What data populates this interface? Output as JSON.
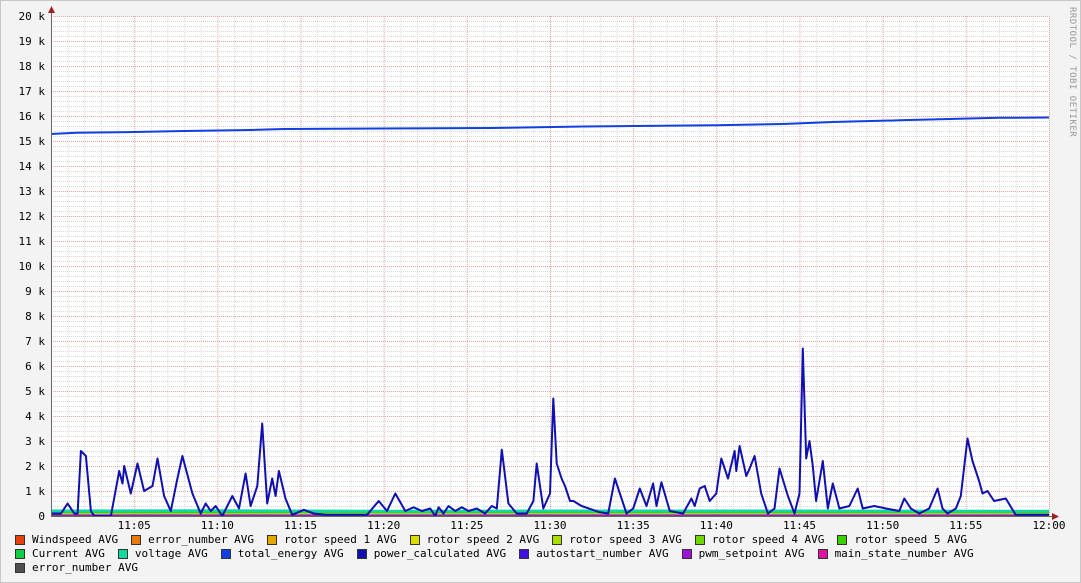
{
  "watermark": "RRDTOOL / TOBI OETIKER",
  "chart_data": {
    "type": "line",
    "title": "",
    "xlabel": "",
    "ylabel": "",
    "x_unit": "minutes after 11:00",
    "xlim": [
      0,
      60
    ],
    "ylim": [
      0,
      20000
    ],
    "grid": true,
    "legend_placement": "bottom",
    "x_ticks": [
      {
        "t": 5,
        "label": "11:05"
      },
      {
        "t": 10,
        "label": "11:10"
      },
      {
        "t": 15,
        "label": "11:15"
      },
      {
        "t": 20,
        "label": "11:20"
      },
      {
        "t": 25,
        "label": "11:25"
      },
      {
        "t": 30,
        "label": "11:30"
      },
      {
        "t": 35,
        "label": "11:35"
      },
      {
        "t": 40,
        "label": "11:40"
      },
      {
        "t": 45,
        "label": "11:45"
      },
      {
        "t": 50,
        "label": "11:50"
      },
      {
        "t": 55,
        "label": "11:55"
      },
      {
        "t": 60,
        "label": "12:00"
      }
    ],
    "y_ticks": [
      {
        "v": 0,
        "label": "0"
      },
      {
        "v": 1000,
        "label": "1 k"
      },
      {
        "v": 2000,
        "label": "2 k"
      },
      {
        "v": 3000,
        "label": "3 k"
      },
      {
        "v": 4000,
        "label": "4 k"
      },
      {
        "v": 5000,
        "label": "5 k"
      },
      {
        "v": 6000,
        "label": "6 k"
      },
      {
        "v": 7000,
        "label": "7 k"
      },
      {
        "v": 8000,
        "label": "8 k"
      },
      {
        "v": 9000,
        "label": "9 k"
      },
      {
        "v": 10000,
        "label": "10 k"
      },
      {
        "v": 11000,
        "label": "11 k"
      },
      {
        "v": 12000,
        "label": "12 k"
      },
      {
        "v": 13000,
        "label": "13 k"
      },
      {
        "v": 14000,
        "label": "14 k"
      },
      {
        "v": 15000,
        "label": "15 k"
      },
      {
        "v": 16000,
        "label": "16 k"
      },
      {
        "v": 17000,
        "label": "17 k"
      },
      {
        "v": 18000,
        "label": "18 k"
      },
      {
        "v": 19000,
        "label": "19 k"
      },
      {
        "v": 20000,
        "label": "20 k"
      }
    ],
    "series": [
      {
        "name": "Windspeed AVG",
        "color": "#e8400c",
        "points": [
          [
            0,
            10
          ],
          [
            60,
            10
          ]
        ]
      },
      {
        "name": "error_number AVG",
        "color": "#e87a0c",
        "points": [
          [
            0,
            0
          ],
          [
            60,
            0
          ]
        ]
      },
      {
        "name": "rotor speed 1 AVG",
        "color": "#e0a800",
        "points": [
          [
            0,
            120
          ],
          [
            60,
            120
          ]
        ]
      },
      {
        "name": "rotor speed 2 AVG",
        "color": "#dcdc00",
        "points": [
          [
            0,
            110
          ],
          [
            60,
            110
          ]
        ]
      },
      {
        "name": "rotor speed 3 AVG",
        "color": "#a8e000",
        "points": [
          [
            0,
            140
          ],
          [
            60,
            140
          ]
        ]
      },
      {
        "name": "rotor speed 4 AVG",
        "color": "#70d800",
        "points": [
          [
            0,
            130
          ],
          [
            60,
            130
          ]
        ]
      },
      {
        "name": "rotor speed 5 AVG",
        "color": "#3cd000",
        "points": [
          [
            0,
            150
          ],
          [
            60,
            150
          ]
        ]
      },
      {
        "name": "Current AVG",
        "color": "#10d040",
        "points": [
          [
            0,
            160
          ],
          [
            60,
            160
          ]
        ]
      },
      {
        "name": "voltage AVG",
        "color": "#10d8a0",
        "points": [
          [
            0,
            200
          ],
          [
            10,
            210
          ],
          [
            20,
            190
          ],
          [
            30,
            200
          ],
          [
            40,
            200
          ],
          [
            50,
            195
          ],
          [
            60,
            190
          ]
        ]
      },
      {
        "name": "total_energy AVG",
        "color": "#1040e0",
        "points": [
          [
            0,
            15280
          ],
          [
            1.5,
            15330
          ],
          [
            5,
            15360
          ],
          [
            8,
            15400
          ],
          [
            12,
            15440
          ],
          [
            14,
            15480
          ],
          [
            26.5,
            15520
          ],
          [
            32,
            15580
          ],
          [
            40,
            15630
          ],
          [
            44,
            15680
          ],
          [
            47,
            15760
          ],
          [
            51,
            15830
          ],
          [
            54,
            15880
          ],
          [
            57,
            15930
          ],
          [
            60,
            15940
          ]
        ]
      },
      {
        "name": "power_calculated AVG",
        "color": "#1010b0",
        "points": [
          [
            0,
            100
          ],
          [
            0.6,
            100
          ],
          [
            1.0,
            500
          ],
          [
            1.4,
            100
          ],
          [
            1.6,
            100
          ],
          [
            1.8,
            2600
          ],
          [
            2.1,
            2400
          ],
          [
            2.4,
            200
          ],
          [
            2.6,
            0
          ],
          [
            3.6,
            0
          ],
          [
            4.1,
            1800
          ],
          [
            4.3,
            1300
          ],
          [
            4.4,
            2000
          ],
          [
            4.8,
            900
          ],
          [
            5.2,
            2100
          ],
          [
            5.6,
            1000
          ],
          [
            6.1,
            1200
          ],
          [
            6.4,
            2300
          ],
          [
            6.8,
            800
          ],
          [
            7.2,
            200
          ],
          [
            7.6,
            1500
          ],
          [
            7.9,
            2400
          ],
          [
            8.5,
            900
          ],
          [
            9.0,
            100
          ],
          [
            9.3,
            500
          ],
          [
            9.6,
            200
          ],
          [
            9.9,
            400
          ],
          [
            10.3,
            0
          ],
          [
            10.9,
            800
          ],
          [
            11.3,
            300
          ],
          [
            11.7,
            1700
          ],
          [
            12.0,
            400
          ],
          [
            12.4,
            1200
          ],
          [
            12.7,
            3700
          ],
          [
            13.0,
            500
          ],
          [
            13.3,
            1500
          ],
          [
            13.5,
            800
          ],
          [
            13.7,
            1800
          ],
          [
            14.1,
            700
          ],
          [
            14.5,
            50
          ],
          [
            15.2,
            250
          ],
          [
            15.8,
            100
          ],
          [
            16.5,
            50
          ],
          [
            19.0,
            50
          ],
          [
            19.7,
            600
          ],
          [
            20.2,
            200
          ],
          [
            20.7,
            900
          ],
          [
            21.3,
            200
          ],
          [
            21.8,
            350
          ],
          [
            22.3,
            200
          ],
          [
            22.8,
            300
          ],
          [
            23.1,
            0
          ],
          [
            23.3,
            350
          ],
          [
            23.6,
            100
          ],
          [
            23.9,
            400
          ],
          [
            24.3,
            200
          ],
          [
            24.7,
            350
          ],
          [
            25.1,
            200
          ],
          [
            25.6,
            300
          ],
          [
            26.1,
            100
          ],
          [
            26.5,
            400
          ],
          [
            26.8,
            300
          ],
          [
            27.1,
            2650
          ],
          [
            27.5,
            500
          ],
          [
            28.0,
            100
          ],
          [
            28.6,
            100
          ],
          [
            29.0,
            600
          ],
          [
            29.2,
            2100
          ],
          [
            29.6,
            300
          ],
          [
            30.0,
            900
          ],
          [
            30.2,
            4700
          ],
          [
            30.4,
            2100
          ],
          [
            30.7,
            1500
          ],
          [
            30.9,
            1200
          ],
          [
            31.2,
            600
          ],
          [
            31.4,
            600
          ],
          [
            31.9,
            400
          ],
          [
            33.0,
            150
          ],
          [
            33.5,
            100
          ],
          [
            33.9,
            1500
          ],
          [
            34.2,
            900
          ],
          [
            34.6,
            100
          ],
          [
            35.0,
            300
          ],
          [
            35.4,
            1100
          ],
          [
            35.8,
            400
          ],
          [
            36.2,
            1300
          ],
          [
            36.4,
            400
          ],
          [
            36.7,
            1350
          ],
          [
            37.2,
            200
          ],
          [
            38.0,
            100
          ],
          [
            38.5,
            700
          ],
          [
            38.7,
            400
          ],
          [
            39.0,
            1100
          ],
          [
            39.3,
            1200
          ],
          [
            39.6,
            600
          ],
          [
            40.0,
            900
          ],
          [
            40.3,
            2300
          ],
          [
            40.7,
            1500
          ],
          [
            41.1,
            2600
          ],
          [
            41.2,
            1800
          ],
          [
            41.4,
            2800
          ],
          [
            41.8,
            1600
          ],
          [
            42.0,
            1900
          ],
          [
            42.3,
            2400
          ],
          [
            42.7,
            900
          ],
          [
            43.1,
            100
          ],
          [
            43.5,
            300
          ],
          [
            43.8,
            1900
          ],
          [
            44.3,
            800
          ],
          [
            44.7,
            100
          ],
          [
            45.0,
            900
          ],
          [
            45.2,
            6700
          ],
          [
            45.4,
            2300
          ],
          [
            45.6,
            3000
          ],
          [
            45.8,
            2000
          ],
          [
            46.0,
            600
          ],
          [
            46.4,
            2200
          ],
          [
            46.7,
            300
          ],
          [
            47.0,
            1300
          ],
          [
            47.4,
            300
          ],
          [
            48.0,
            400
          ],
          [
            48.5,
            1100
          ],
          [
            48.8,
            300
          ],
          [
            49.5,
            400
          ],
          [
            50.2,
            300
          ],
          [
            51.0,
            200
          ],
          [
            51.3,
            700
          ],
          [
            51.7,
            300
          ],
          [
            52.2,
            100
          ],
          [
            52.8,
            300
          ],
          [
            53.3,
            1100
          ],
          [
            53.6,
            300
          ],
          [
            53.9,
            100
          ],
          [
            54.4,
            300
          ],
          [
            54.7,
            800
          ],
          [
            55.1,
            3100
          ],
          [
            55.4,
            2200
          ],
          [
            55.8,
            1400
          ],
          [
            56.0,
            900
          ],
          [
            56.3,
            1000
          ],
          [
            56.7,
            600
          ],
          [
            57.4,
            700
          ],
          [
            58.0,
            50
          ],
          [
            60,
            50
          ]
        ]
      },
      {
        "name": "autostart_number AVG",
        "color": "#4010e0",
        "points": [
          [
            0,
            0
          ],
          [
            60,
            0
          ]
        ]
      },
      {
        "name": "pwm_setpoint AVG",
        "color": "#a010d8",
        "points": [
          [
            0,
            40
          ],
          [
            60,
            40
          ]
        ]
      },
      {
        "name": "main_state_number AVG",
        "color": "#e010a0",
        "points": [
          [
            0,
            20
          ],
          [
            60,
            20
          ]
        ]
      },
      {
        "name": "error_number AVG",
        "color": "#505050",
        "points": [
          [
            0,
            0
          ],
          [
            60,
            0
          ]
        ]
      }
    ]
  }
}
